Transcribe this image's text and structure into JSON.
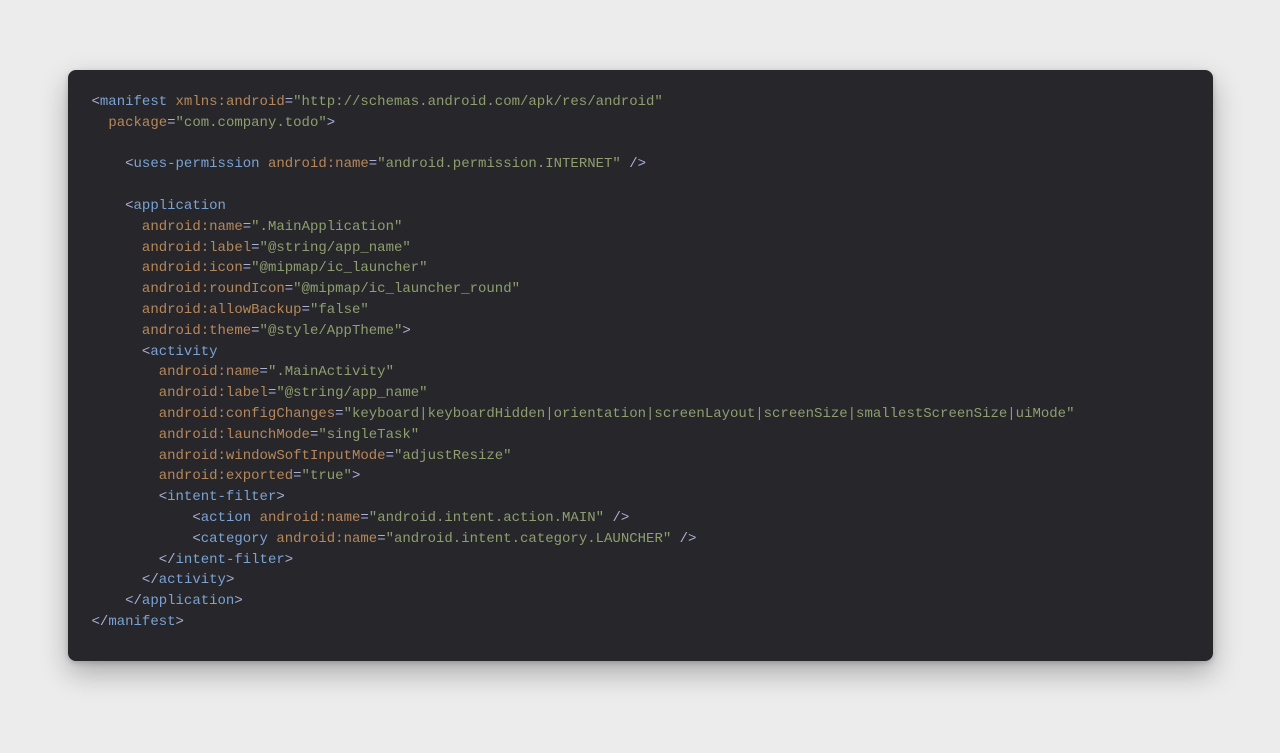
{
  "code": {
    "lines": [
      {
        "indent": 0,
        "parts": [
          {
            "t": "<",
            "c": "p"
          },
          {
            "t": "manifest",
            "c": "tag"
          },
          {
            "t": " ",
            "c": "p"
          },
          {
            "t": "xmlns:android",
            "c": "attr"
          },
          {
            "t": "=",
            "c": "op"
          },
          {
            "t": "\"http://schemas.android.com/apk/res/android\"",
            "c": "str"
          }
        ]
      },
      {
        "indent": 1,
        "parts": [
          {
            "t": "package",
            "c": "attr"
          },
          {
            "t": "=",
            "c": "op"
          },
          {
            "t": "\"com.company.todo\"",
            "c": "str"
          },
          {
            "t": ">",
            "c": "op"
          }
        ]
      },
      {
        "indent": 0,
        "parts": []
      },
      {
        "indent": 2,
        "parts": [
          {
            "t": "<",
            "c": "p"
          },
          {
            "t": "uses-permission",
            "c": "tag"
          },
          {
            "t": " ",
            "c": "p"
          },
          {
            "t": "android:name",
            "c": "attr"
          },
          {
            "t": "=",
            "c": "op"
          },
          {
            "t": "\"android.permission.INTERNET\"",
            "c": "str"
          },
          {
            "t": " />",
            "c": "op"
          }
        ]
      },
      {
        "indent": 0,
        "parts": []
      },
      {
        "indent": 2,
        "parts": [
          {
            "t": "<",
            "c": "p"
          },
          {
            "t": "application",
            "c": "tag"
          }
        ]
      },
      {
        "indent": 3,
        "parts": [
          {
            "t": "android:name",
            "c": "attr"
          },
          {
            "t": "=",
            "c": "op"
          },
          {
            "t": "\".MainApplication\"",
            "c": "str"
          }
        ]
      },
      {
        "indent": 3,
        "parts": [
          {
            "t": "android:label",
            "c": "attr"
          },
          {
            "t": "=",
            "c": "op"
          },
          {
            "t": "\"@string/app_name\"",
            "c": "str"
          }
        ]
      },
      {
        "indent": 3,
        "parts": [
          {
            "t": "android:icon",
            "c": "attr"
          },
          {
            "t": "=",
            "c": "op"
          },
          {
            "t": "\"@mipmap/ic_launcher\"",
            "c": "str"
          }
        ]
      },
      {
        "indent": 3,
        "parts": [
          {
            "t": "android:roundIcon",
            "c": "attr"
          },
          {
            "t": "=",
            "c": "op"
          },
          {
            "t": "\"@mipmap/ic_launcher_round\"",
            "c": "str"
          }
        ]
      },
      {
        "indent": 3,
        "parts": [
          {
            "t": "android:allowBackup",
            "c": "attr"
          },
          {
            "t": "=",
            "c": "op"
          },
          {
            "t": "\"false\"",
            "c": "str"
          }
        ]
      },
      {
        "indent": 3,
        "parts": [
          {
            "t": "android:theme",
            "c": "attr"
          },
          {
            "t": "=",
            "c": "op"
          },
          {
            "t": "\"@style/AppTheme\"",
            "c": "str"
          },
          {
            "t": ">",
            "c": "op"
          }
        ]
      },
      {
        "indent": 3,
        "parts": [
          {
            "t": "<",
            "c": "p"
          },
          {
            "t": "activity",
            "c": "tag"
          }
        ]
      },
      {
        "indent": 4,
        "parts": [
          {
            "t": "android:name",
            "c": "attr"
          },
          {
            "t": "=",
            "c": "op"
          },
          {
            "t": "\".MainActivity\"",
            "c": "str"
          }
        ]
      },
      {
        "indent": 4,
        "parts": [
          {
            "t": "android:label",
            "c": "attr"
          },
          {
            "t": "=",
            "c": "op"
          },
          {
            "t": "\"@string/app_name\"",
            "c": "str"
          }
        ]
      },
      {
        "indent": 4,
        "parts": [
          {
            "t": "android:configChanges",
            "c": "attr"
          },
          {
            "t": "=",
            "c": "op"
          },
          {
            "t": "\"keyboard|keyboardHidden|orientation|screenLayout|screenSize|smallestScreenSize|uiMode\"",
            "c": "str"
          }
        ]
      },
      {
        "indent": 4,
        "parts": [
          {
            "t": "android:launchMode",
            "c": "attr"
          },
          {
            "t": "=",
            "c": "op"
          },
          {
            "t": "\"singleTask\"",
            "c": "str"
          }
        ]
      },
      {
        "indent": 4,
        "parts": [
          {
            "t": "android:windowSoftInputMode",
            "c": "attr"
          },
          {
            "t": "=",
            "c": "op"
          },
          {
            "t": "\"adjustResize\"",
            "c": "str"
          }
        ]
      },
      {
        "indent": 4,
        "parts": [
          {
            "t": "android:exported",
            "c": "attr"
          },
          {
            "t": "=",
            "c": "op"
          },
          {
            "t": "\"true\"",
            "c": "str"
          },
          {
            "t": ">",
            "c": "op"
          }
        ]
      },
      {
        "indent": 4,
        "parts": [
          {
            "t": "<",
            "c": "p"
          },
          {
            "t": "intent-filter",
            "c": "tag"
          },
          {
            "t": ">",
            "c": "op"
          }
        ]
      },
      {
        "indent": 6,
        "parts": [
          {
            "t": "<",
            "c": "p"
          },
          {
            "t": "action",
            "c": "tag"
          },
          {
            "t": " ",
            "c": "p"
          },
          {
            "t": "android:name",
            "c": "attr"
          },
          {
            "t": "=",
            "c": "op"
          },
          {
            "t": "\"android.intent.action.MAIN\"",
            "c": "str"
          },
          {
            "t": " />",
            "c": "op"
          }
        ]
      },
      {
        "indent": 6,
        "parts": [
          {
            "t": "<",
            "c": "p"
          },
          {
            "t": "category",
            "c": "tag"
          },
          {
            "t": " ",
            "c": "p"
          },
          {
            "t": "android:name",
            "c": "attr"
          },
          {
            "t": "=",
            "c": "op"
          },
          {
            "t": "\"android.intent.category.LAUNCHER\"",
            "c": "str"
          },
          {
            "t": " />",
            "c": "op"
          }
        ]
      },
      {
        "indent": 4,
        "parts": [
          {
            "t": "</",
            "c": "p"
          },
          {
            "t": "intent-filter",
            "c": "tag"
          },
          {
            "t": ">",
            "c": "op"
          }
        ]
      },
      {
        "indent": 3,
        "parts": [
          {
            "t": "</",
            "c": "p"
          },
          {
            "t": "activity",
            "c": "tag"
          },
          {
            "t": ">",
            "c": "op"
          }
        ]
      },
      {
        "indent": 2,
        "parts": [
          {
            "t": "</",
            "c": "p"
          },
          {
            "t": "application",
            "c": "tag"
          },
          {
            "t": ">",
            "c": "op"
          }
        ]
      },
      {
        "indent": 0,
        "parts": [
          {
            "t": "</",
            "c": "p"
          },
          {
            "t": "manifest",
            "c": "tag"
          },
          {
            "t": ">",
            "c": "op"
          }
        ]
      }
    ]
  }
}
